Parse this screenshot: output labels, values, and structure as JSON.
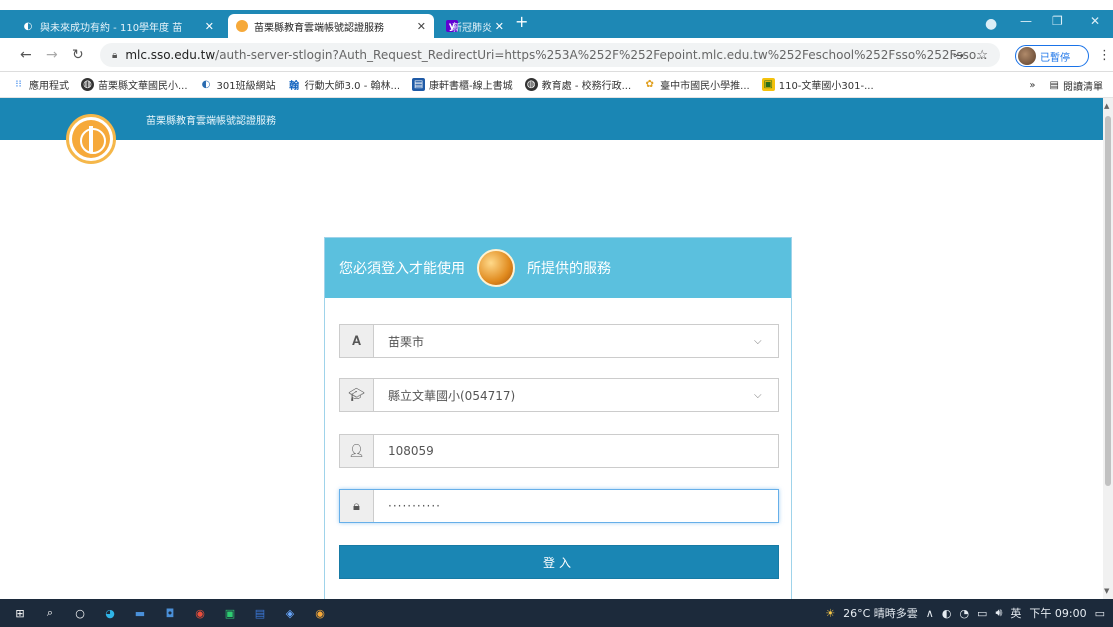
{
  "tabs": [
    {
      "title": "與未來成功有約 - 110學年度 苗",
      "active": false,
      "icon": "web-icon"
    },
    {
      "title": "苗栗縣教育雲端帳號認證服務",
      "active": true,
      "icon": "site-icon"
    },
    {
      "title": "新冠肺炎延燒 疫情不斷更新 - Ya",
      "active": false,
      "icon": "yahoo-icon"
    }
  ],
  "address": {
    "host": "mlc.sso.edu.tw",
    "path": "/auth-server-stlogin?Auth_Request_RedirectUri=https%253A%252F%252Fepoint.mlc.edu.tw%252Feschool%252Fsso%252Fsso..."
  },
  "profile": {
    "label": "已暫停"
  },
  "bookmarks": [
    {
      "label": "應用程式",
      "icon": "apps-icon"
    },
    {
      "label": "苗栗縣文華國民小...",
      "icon": "globe-icon"
    },
    {
      "label": "301班級網站",
      "icon": "web-icon"
    },
    {
      "label": "行動大師3.0 - 翰林...",
      "icon": "hanlin-icon"
    },
    {
      "label": "康軒書櫃-線上書城",
      "icon": "book-icon"
    },
    {
      "label": "教育處 - 校務行政...",
      "icon": "globe-icon"
    },
    {
      "label": "臺中市國民小學推...",
      "icon": "flower-icon"
    },
    {
      "label": "110-文華國小301-...",
      "icon": "photo-icon"
    }
  ],
  "bookmarks_more": "»",
  "reading_list": "閱讀清單",
  "site": {
    "title": "苗栗縣教育雲端帳號認證服務"
  },
  "login": {
    "header_left": "您必須登入才能使用",
    "header_right": "所提供的服務",
    "city": "苗栗市",
    "school": "縣立文華國小(054717)",
    "username": "108059",
    "password": "···········",
    "button": "登入"
  },
  "taskbar": {
    "weather": "26°C 晴時多雲",
    "ime": "英",
    "time": "下午 09:00"
  }
}
